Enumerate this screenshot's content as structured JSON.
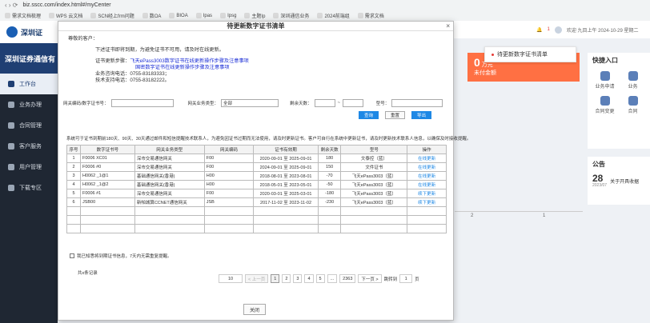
{
  "browser": {
    "url": "biz.sscc.com/index.html#/myCenter",
    "bookmarks": [
      "需求文档梳理",
      "WPS 云文档",
      "SCN经上frm问题",
      "数OA",
      "BIOA",
      "Ipas",
      "Ipsg",
      "主题Ip",
      "深圳通信业务",
      "2024前端组",
      "需求文档"
    ]
  },
  "sidebar": {
    "logo_text": "深圳证",
    "corp_name": "深圳证券通信有",
    "items": [
      {
        "label": "工作台"
      },
      {
        "label": "业务办理"
      },
      {
        "label": "合同管理"
      },
      {
        "label": "客户服务"
      },
      {
        "label": "用户管理"
      },
      {
        "label": "下载专区"
      }
    ]
  },
  "topbar": {
    "greeting": "欢迎 九目上午 2024-10-29 星期二",
    "badge": "1"
  },
  "notification": {
    "text": "待更新数字证书清单"
  },
  "background": {
    "card_value": "0",
    "card_unit": "万元",
    "card_label": "未付金额",
    "quick_title": "快捷入口",
    "quick_items": [
      "业务申请",
      "业务",
      "合同变更",
      "合同"
    ],
    "notice_title": "公告",
    "notice_day": "28",
    "notice_ym": "2023/07",
    "notice_text": "关于开具收据",
    "chart_ticks": [
      "2",
      "1"
    ]
  },
  "modal": {
    "title": "待更新数字证书清单",
    "close_icon": "×",
    "salutation": "尊敬的客户：",
    "line1": "下述证书即将到期，为避免证书不可用，请及时在线更新。",
    "steps_label": "证书更新步骤：",
    "steps_link1": "飞天ePass3003数字证书在线更新操作步骤及注意事项",
    "steps_link2": "国密数字证书在线更新操作步骤及注意事项",
    "consult_label": "业务咨询电话：",
    "consult_phone": "0755-83183333；",
    "tech_label": "技术支持电话：",
    "tech_phone": "0755-83182222。",
    "filters": {
      "net_code_label": "网关编码/数字证书号：",
      "biz_type_label": "网关业务类型：",
      "biz_type_value": "全部",
      "days_label": "剩余天数：",
      "days_sep": "~",
      "model_label": "型号："
    },
    "buttons": {
      "query": "查询",
      "reset": "重置",
      "export": "导出"
    },
    "hint": "系统可于证书到期前180天、90天、30天通过邮件和短信提醒技术联系人，为避免因证书过期而无法使用，请及时更新证书。客户可自行在系统中更新证书，请及时更新技术联系人信息，以确保及时接收提醒。",
    "table": {
      "headers": [
        "序号",
        "数字证书号",
        "网关业务类型",
        "网关编码",
        "证书有效期",
        "剩余天数",
        "型号",
        "操作"
      ],
      "rows": [
        [
          "1",
          "F0006  XC01",
          "深市交易通信网关",
          "F00",
          "2020-09-01 至 2025-09-01",
          "180",
          "文泰控（蓝）",
          "在线更新"
        ],
        [
          "2",
          "F0006  #0",
          "深市交易通信网关",
          "F00",
          "2024-09-01 至 2025-09-01",
          "150",
          "文件证书",
          "在线更新"
        ],
        [
          "3",
          "H0062  _1@1",
          "基础通信网关(香港)",
          "H00",
          "2018-08-01 至 2023-08-01",
          "-70",
          "飞天ePass3003（蓝）",
          "在线更新"
        ],
        [
          "4",
          "H0062  _1@2",
          "基础通信网关(香港)",
          "H00",
          "2018-05-01 至 2023-05-01",
          "-50",
          "飞天ePass3003（蓝）",
          "在线更新"
        ],
        [
          "5",
          "F0006  #1",
          "深市交易通信网关",
          "F00",
          "2020-03-01 至 2025-03-01",
          "-180",
          "飞天ePass3003（蓝）",
          "续下更新"
        ],
        [
          "6",
          "JSB00",
          "新帕城算CCNET通信网关",
          "JSB",
          "2017-11-02 至 2023-11-02",
          "-230",
          "飞天ePass3003（蓝）",
          "续下更新"
        ]
      ]
    },
    "remember_label": "我已知悉将到期证书信息，7天内无需重复提醒。",
    "total_label": "共x条记录",
    "pager": {
      "size": "10",
      "prev": "< 上一页",
      "pages": [
        "1",
        "2",
        "3",
        "4",
        "5",
        "...",
        "2363"
      ],
      "next": "下一页 >",
      "goto_label": "跳转到",
      "goto_value": "1",
      "goto_unit": "页"
    },
    "close_label": "关闭"
  }
}
